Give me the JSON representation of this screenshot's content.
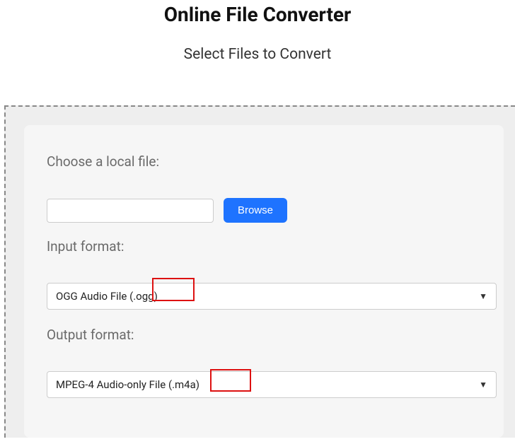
{
  "header": {
    "title": "Online File Converter",
    "subtitle": "Select Files to Convert"
  },
  "form": {
    "local_file_label": "Choose a local file:",
    "browse_label": "Browse",
    "input_format_label": "Input format:",
    "output_format_label": "Output format:",
    "input_format_selected": "OGG Audio File (.ogg)",
    "output_format_selected": "MPEG-4 Audio-only File (.m4a)"
  }
}
